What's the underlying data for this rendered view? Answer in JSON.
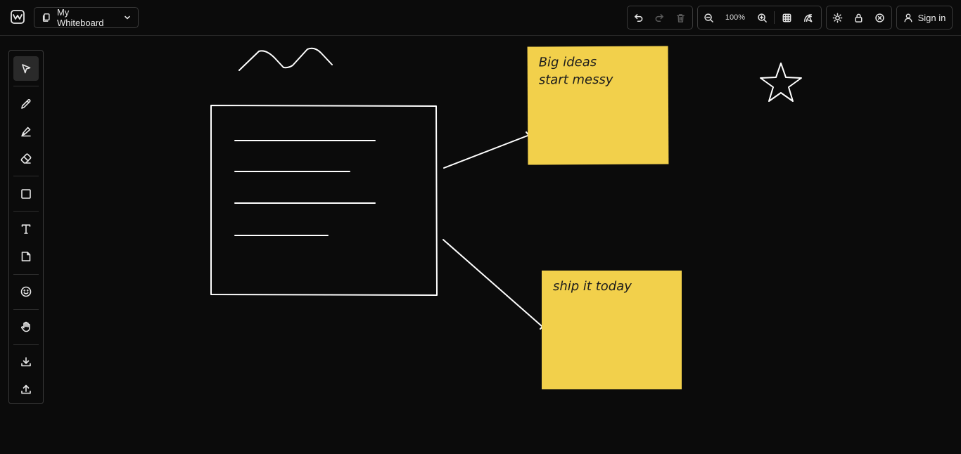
{
  "header": {
    "board_name": "My Whiteboard",
    "zoom_level": "100%",
    "sign_in_label": "Sign in"
  },
  "toolbar": {
    "tools": [
      "select",
      "pencil",
      "highlighter",
      "eraser",
      "rectangle",
      "text",
      "sticky-note",
      "emoji",
      "hand",
      "download",
      "upload"
    ],
    "active_tool": "select"
  },
  "canvas": {
    "sticky_notes": [
      {
        "text": "Big ideas\nstart messy",
        "color": "#f2d04b"
      },
      {
        "text": "ship it today",
        "color": "#f2d04b"
      }
    ],
    "stroke_color": "#ffffff",
    "background_color": "#0b0b0b"
  }
}
